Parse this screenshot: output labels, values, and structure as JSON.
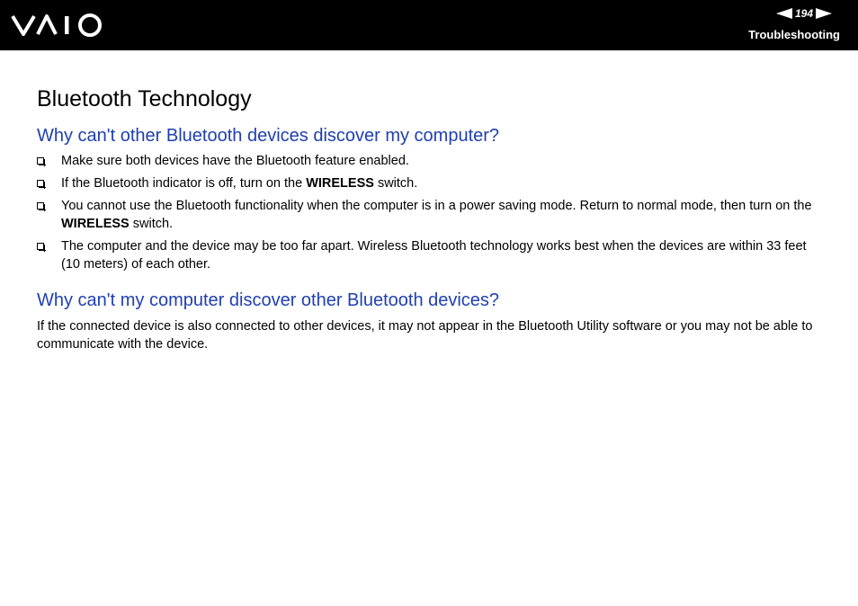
{
  "header": {
    "logo_text": "VAIO",
    "page_number": "194",
    "section": "Troubleshooting",
    "icons": [
      "previous-page-arrow-icon",
      "next-page-arrow-icon"
    ]
  },
  "document": {
    "title": "Bluetooth Technology",
    "sections": [
      {
        "heading": "Why can't other Bluetooth devices discover my computer?",
        "items": [
          {
            "before": "Make sure both devices have the Bluetooth feature enabled.",
            "bold": "",
            "after": ""
          },
          {
            "before": "If the Bluetooth indicator is off, turn on the ",
            "bold": "WIRELESS",
            "after": " switch."
          },
          {
            "before": "You cannot use the Bluetooth functionality when the computer is in a power saving mode. Return to normal mode, then turn on the ",
            "bold": "WIRELESS",
            "after": " switch."
          },
          {
            "before": "The computer and the device may be too far apart. Wireless Bluetooth technology works best when the devices are within 33 feet (10 meters) of each other.",
            "bold": "",
            "after": ""
          }
        ]
      },
      {
        "heading": "Why can't my computer discover other Bluetooth devices?",
        "paragraph": "If the connected device is also connected to other devices, it may not appear in the Bluetooth Utility software or you may not be able to communicate with the device."
      }
    ]
  },
  "colors": {
    "header_background": "#000000",
    "heading_blue": "#1f3fb1",
    "text": "#000000"
  }
}
